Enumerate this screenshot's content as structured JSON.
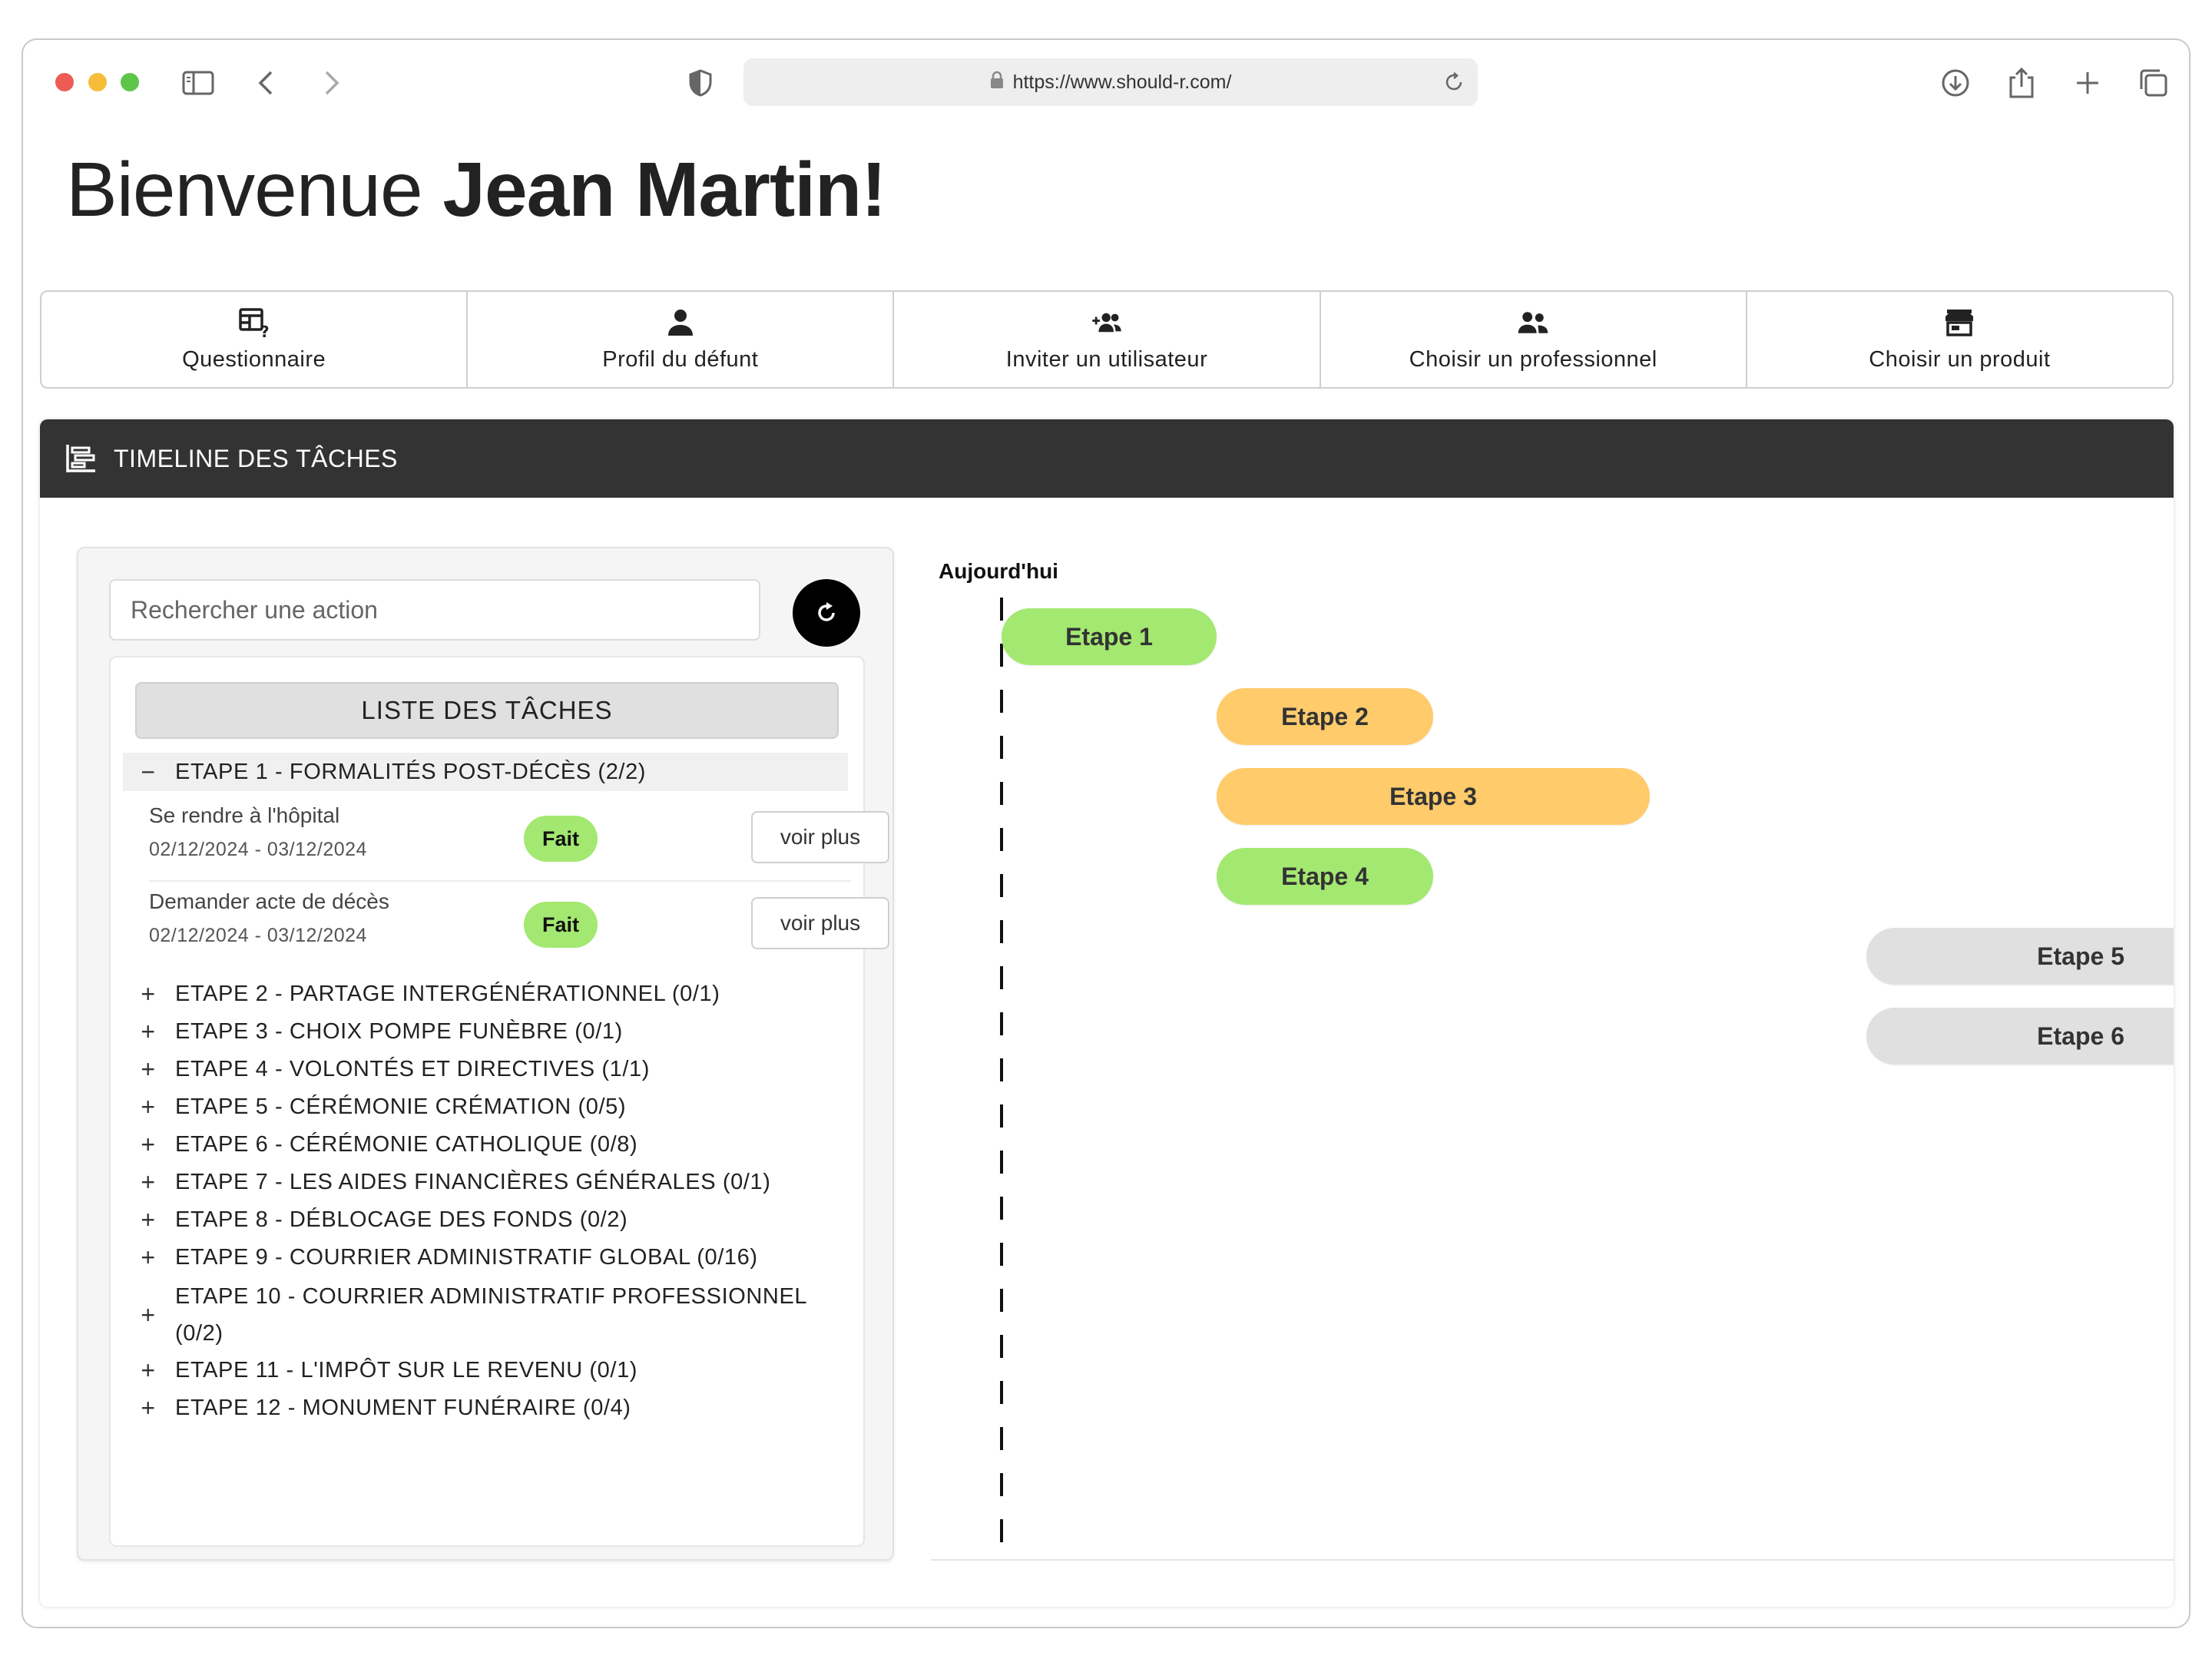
{
  "browser": {
    "url": "https://www.should-r.com/"
  },
  "page": {
    "greeting": "Bienvenue",
    "user_name": "Jean Martin!"
  },
  "nav": [
    {
      "label": "Questionnaire",
      "icon": "table-question-icon"
    },
    {
      "label": "Profil du défunt",
      "icon": "person-icon"
    },
    {
      "label": "Inviter un utilisateur",
      "icon": "group-add-icon"
    },
    {
      "label": "Choisir un professionnel",
      "icon": "people-icon"
    },
    {
      "label": "Choisir un produit",
      "icon": "store-icon"
    }
  ],
  "section": {
    "title": "TIMELINE DES TÂCHES"
  },
  "search": {
    "placeholder": "Rechercher une action"
  },
  "task_list": {
    "title": "LISTE DES TÂCHES",
    "steps": [
      {
        "label": "ETAPE 1 - FORMALITÉS POST-DÉCÈS (2/2)",
        "expanded": true,
        "sign": "−"
      },
      {
        "label": "ETAPE 2 - PARTAGE INTERGÉNÉRATIONNEL (0/1)",
        "sign": "+"
      },
      {
        "label": "ETAPE 3 - CHOIX POMPE FUNÈBRE (0/1)",
        "sign": "+"
      },
      {
        "label": "ETAPE 4 - VOLONTÉS ET DIRECTIVES (1/1)",
        "sign": "+"
      },
      {
        "label": "ETAPE 5 - CÉRÉMONIE CRÉMATION (0/5)",
        "sign": "+"
      },
      {
        "label": "ETAPE 6 - CÉRÉMONIE CATHOLIQUE (0/8)",
        "sign": "+"
      },
      {
        "label": "ETAPE 7 - LES AIDES FINANCIÈRES GÉNÉRALES (0/1)",
        "sign": "+"
      },
      {
        "label": "ETAPE 8 - DÉBLOCAGE DES FONDS (0/2)",
        "sign": "+"
      },
      {
        "label": "ETAPE 9 - COURRIER ADMINISTRATIF GLOBAL (0/16)",
        "sign": "+"
      },
      {
        "label": "ETAPE 10 - COURRIER ADMINISTRATIF PROFESSIONNEL",
        "label_line2": "(0/2)",
        "sign": "+"
      },
      {
        "label": "ETAPE 11 - L'IMPÔT SUR LE REVENU (0/1)",
        "sign": "+"
      },
      {
        "label": "ETAPE 12 - MONUMENT FUNÉRAIRE (0/4)",
        "sign": "+"
      }
    ],
    "tasks": [
      {
        "name": "Se rendre à l'hôpital",
        "dates": "02/12/2024 - 03/12/2024",
        "status": "Fait",
        "action": "voir plus"
      },
      {
        "name": "Demander acte de décès",
        "dates": "02/12/2024 - 03/12/2024",
        "status": "Fait",
        "action": "voir plus"
      }
    ]
  },
  "timeline": {
    "today_label": "Aujourd'hui",
    "bars": [
      {
        "label": "Etape 1",
        "color": "#a3e870"
      },
      {
        "label": "Etape 2",
        "color": "#ffcb6b"
      },
      {
        "label": "Etape 3",
        "color": "#ffcb6b"
      },
      {
        "label": "Etape 4",
        "color": "#a3e870"
      },
      {
        "label": "Etape 5",
        "color": "#e0e0e0"
      },
      {
        "label": "Etape 6",
        "color": "#e0e0e0"
      }
    ]
  },
  "colors": {
    "header_bg": "#333333",
    "done_badge": "#a3e870",
    "pending": "#ffcb6b",
    "future": "#e0e0e0"
  }
}
